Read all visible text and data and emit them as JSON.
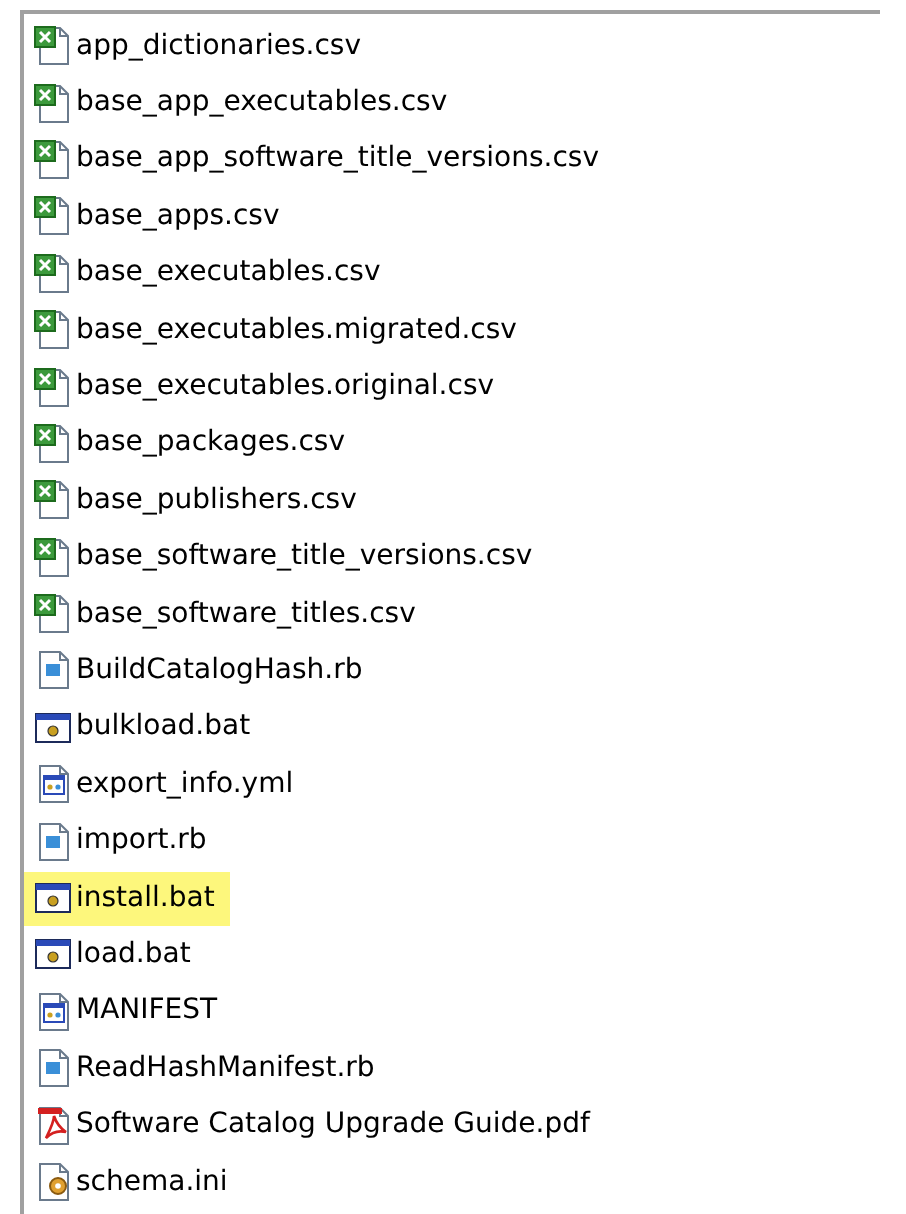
{
  "files": [
    {
      "name": "app_dictionaries.csv",
      "kind": "spreadsheet",
      "selected": false
    },
    {
      "name": "base_app_executables.csv",
      "kind": "spreadsheet",
      "selected": false
    },
    {
      "name": "base_app_software_title_versions.csv",
      "kind": "spreadsheet",
      "selected": false
    },
    {
      "name": "base_apps.csv",
      "kind": "spreadsheet",
      "selected": false
    },
    {
      "name": "base_executables.csv",
      "kind": "spreadsheet",
      "selected": false
    },
    {
      "name": "base_executables.migrated.csv",
      "kind": "spreadsheet",
      "selected": false
    },
    {
      "name": "base_executables.original.csv",
      "kind": "spreadsheet",
      "selected": false
    },
    {
      "name": "base_packages.csv",
      "kind": "spreadsheet",
      "selected": false
    },
    {
      "name": "base_publishers.csv",
      "kind": "spreadsheet",
      "selected": false
    },
    {
      "name": "base_software_title_versions.csv",
      "kind": "spreadsheet",
      "selected": false
    },
    {
      "name": "base_software_titles.csv",
      "kind": "spreadsheet",
      "selected": false
    },
    {
      "name": "BuildCatalogHash.rb",
      "kind": "script",
      "selected": false
    },
    {
      "name": "bulkload.bat",
      "kind": "batch",
      "selected": false
    },
    {
      "name": "export_info.yml",
      "kind": "config",
      "selected": false
    },
    {
      "name": "import.rb",
      "kind": "script",
      "selected": false
    },
    {
      "name": "install.bat",
      "kind": "batch",
      "selected": true
    },
    {
      "name": "load.bat",
      "kind": "batch",
      "selected": false
    },
    {
      "name": "MANIFEST",
      "kind": "config",
      "selected": false
    },
    {
      "name": "ReadHashManifest.rb",
      "kind": "script",
      "selected": false
    },
    {
      "name": "Software Catalog Upgrade Guide.pdf",
      "kind": "pdf",
      "selected": false
    },
    {
      "name": "schema.ini",
      "kind": "settings",
      "selected": false
    }
  ]
}
